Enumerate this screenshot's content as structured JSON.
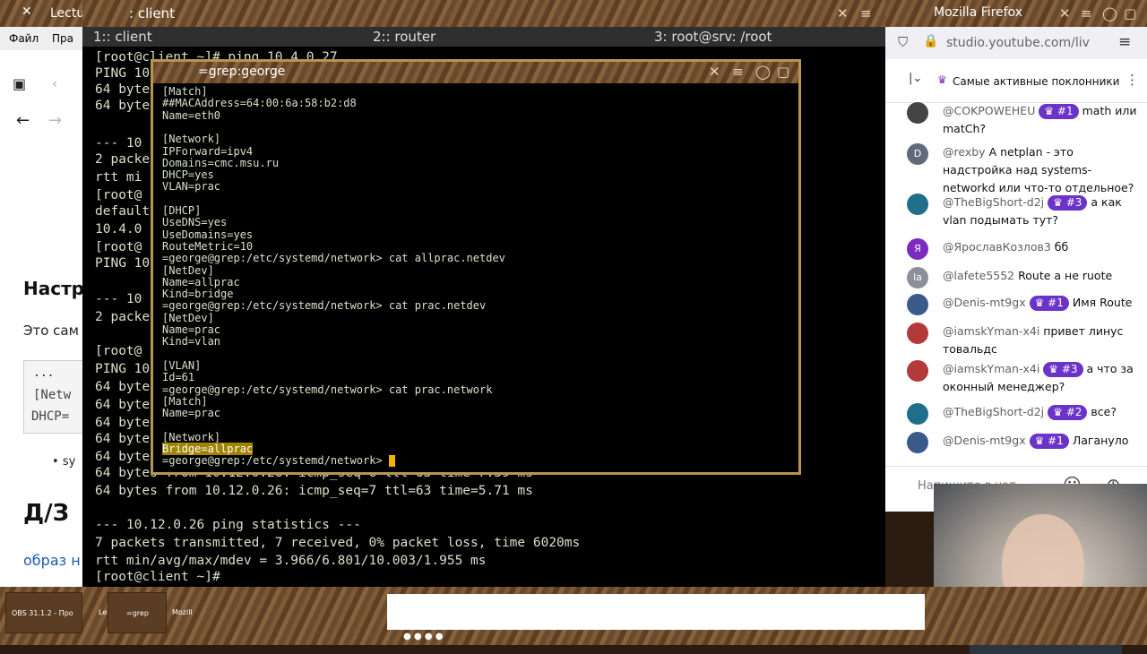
{
  "lecture": {
    "title": "Lectu",
    "menu_file": "Файл",
    "menu_2": "Пра",
    "heading1": "Настр",
    "text1": "Это сам",
    "box_l1": "...",
    "box_l2": "[Netw",
    "box_l3": "DHCP=",
    "bullet": "sy",
    "heading2": "Д/З",
    "link": "образ н"
  },
  "terminal": {
    "title": ": client",
    "tabs": [
      "1:: client",
      "2:: router",
      "3: root@srv: /root"
    ],
    "lines": [
      "[root@client ~]# ping 10.4.0.27",
      "PING 10",
      "64 byte",
      "64 byte",
      "",
      "--- 10",
      "2 packe",
      "rtt mi",
      "[root@",
      "default",
      "10.4.0",
      "[root@",
      "PING 10",
      "",
      "--- 10",
      "2 packe",
      "",
      "[root@",
      "PING 10",
      "64 byte",
      "64 byte",
      "64 byte",
      "64 byte",
      "64 byte",
      "64 bytes from 10.12.0.26: icmp_seq=6 ttl=63 time=7.59 ms",
      "64 bytes from 10.12.0.26: icmp_seq=7 ttl=63 time=5.71 ms",
      "",
      "--- 10.12.0.26 ping statistics ---",
      "7 packets transmitted, 7 received, 0% packet loss, time 6020ms",
      "rtt min/avg/max/mdev = 3.966/6.801/10.003/1.955 ms",
      "[root@client ~]# "
    ]
  },
  "grep_window": {
    "title": "=grep:george",
    "lines": [
      "[Match]",
      "##MACAddress=64:00:6a:58:b2:d8",
      "Name=eth0",
      "",
      "[Network]",
      "IPForward=ipv4",
      "Domains=cmc.msu.ru",
      "DHCP=yes",
      "VLAN=prac",
      "",
      "[DHCP]",
      "UseDNS=yes",
      "UseDomains=yes",
      "RouteMetric=10",
      "=george@grep:/etc/systemd/network> cat allprac.netdev",
      "[NetDev]",
      "Name=allprac",
      "Kind=bridge",
      "=george@grep:/etc/systemd/network> cat prac.netdev",
      "[NetDev]",
      "Name=prac",
      "Kind=vlan",
      "",
      "[VLAN]",
      "Id=61",
      "=george@grep:/etc/systemd/network> cat prac.network",
      "[Match]",
      "Name=prac",
      "",
      "[Network]",
      "Bridge=allprac",
      "=george@grep:/etc/systemd/network> "
    ]
  },
  "chat": {
    "window_title": "Mozilla Firefox",
    "url": "studio.youtube.com/liv",
    "filter_label": "Самые активные поклонники",
    "input_placeholder": "Напишите в чат",
    "messages": [
      {
        "author": "@COKPOWEHEU",
        "badge": "#1",
        "text": "math или matCh?",
        "avatar_text": "",
        "avatar_color": "#444444"
      },
      {
        "author": "@rexby",
        "badge": "",
        "text": "A netplan - это надстройка над systems-networkd или что-то отдельное?",
        "avatar_text": "D",
        "avatar_color": "#5f6b7a"
      },
      {
        "author": "@TheBigShort-d2j",
        "badge": "#3",
        "text": "а как vlan подымать тут?",
        "avatar_text": "",
        "avatar_color": "#1f6f8b"
      },
      {
        "author": "@ЯрославКозлов3",
        "badge": "",
        "text": "бб",
        "avatar_text": "Я",
        "avatar_color": "#7b2cbf"
      },
      {
        "author": "@lafete5552",
        "badge": "",
        "text": "Route а не ruote",
        "avatar_text": "la",
        "avatar_color": "#8a8f99"
      },
      {
        "author": "@Denis-mt9gx",
        "badge": "#1",
        "text": "Имя Route",
        "avatar_text": "",
        "avatar_color": "#3a5a8c"
      },
      {
        "author": "@iamskYman-x4i",
        "badge": "",
        "text": "привет линус товальдс",
        "avatar_text": "",
        "avatar_color": "#b23a3a"
      },
      {
        "author": "@iamskYman-x4i",
        "badge": "#3",
        "text": "а что за оконный менеджер?",
        "avatar_text": "",
        "avatar_color": "#b23a3a"
      },
      {
        "author": "@TheBigShort-d2j",
        "badge": "#2",
        "text": "все?",
        "avatar_text": "",
        "avatar_color": "#1f6f8b"
      },
      {
        "author": "@Denis-mt9gx",
        "badge": "#1",
        "text": "Лагануло",
        "avatar_text": "",
        "avatar_color": "#3a5a8c"
      }
    ]
  },
  "taskbar": {
    "items": [
      "OBS 31.1.2 - Про",
      "Le",
      "=grep",
      "Mozill"
    ]
  },
  "colors": {
    "badge": "#6b33c8",
    "terminal_text": "#d8e0c8",
    "cursor": "#f0b400",
    "highlight": "#a08400"
  }
}
